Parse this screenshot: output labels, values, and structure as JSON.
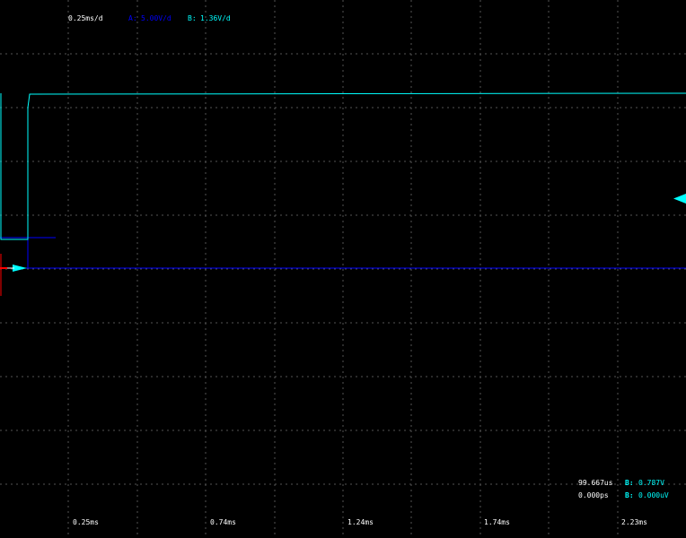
{
  "header": {
    "timebase": "0.25ms/d",
    "channel_a_label": "A:",
    "channel_a_scale": "5.00V/d",
    "channel_b_label": "B:",
    "channel_b_scale": "1.36V/d"
  },
  "measurements": {
    "row1_time": "99.667us",
    "row1_channel": "B:",
    "row1_value": "0.787V",
    "row2_time": "0.000ps",
    "row2_channel": "B:",
    "row2_value": "0.000uV"
  },
  "x_ticks": [
    "0.25ms",
    "0.74ms",
    "1.24ms",
    "1.74ms",
    "2.23ms"
  ],
  "colors": {
    "background": "#000000",
    "grid": "#555555",
    "channel_a": "#0000ff",
    "channel_b": "#00ffff",
    "trigger": "#ff0000",
    "text": "#ffffff"
  },
  "icons": {
    "channel_b_level_marker": "left-pointing-triangle",
    "ground_marker": "right-pointing-triangle"
  }
}
